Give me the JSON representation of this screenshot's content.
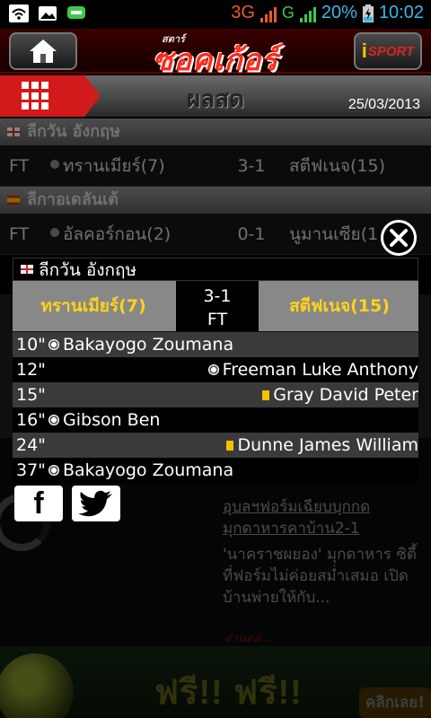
{
  "status_bar": {
    "network": "3G",
    "network2": "G",
    "battery": "20%",
    "time": "10:02"
  },
  "header": {
    "logo_small": "สตาร์",
    "logo_main": "ซอคเก้อร์",
    "right_button_i": "i",
    "right_button_text": "SPORT"
  },
  "titlebar": {
    "title": "ผลสด",
    "date": "25/03/2013"
  },
  "background_list": {
    "leagues": [
      {
        "name": "ลีกวัน  อังกฤษ",
        "matches": [
          {
            "status": "FT",
            "home": "ทรานเมียร์(7)",
            "score": "3-1",
            "away": "สตีฟเนจ(15)"
          }
        ]
      },
      {
        "name": "ลีกาอเดลันเต้",
        "matches": [
          {
            "status": "FT",
            "home": "อัลคอร์กอน(2)",
            "score": "0-1",
            "away": "นูมานเซีย(1"
          }
        ]
      }
    ]
  },
  "popup": {
    "league": "ลีกวัน อังกฤษ",
    "home_team": "ทรานเมียร์(7)",
    "away_team": "สตีฟเนจ(15)",
    "score": "3-1",
    "status": "FT",
    "events": [
      {
        "minute": "10\"",
        "side": "home",
        "type": "goal",
        "player": "Bakayogo Zoumana"
      },
      {
        "minute": "12\"",
        "side": "away",
        "type": "goal",
        "player": "Freeman Luke Anthony"
      },
      {
        "minute": "15\"",
        "side": "away",
        "type": "yellow-card",
        "player": "Gray David  Peter"
      },
      {
        "minute": "16\"",
        "side": "home",
        "type": "goal",
        "player": "Gibson Ben"
      },
      {
        "minute": "24\"",
        "side": "away",
        "type": "yellow-card",
        "player": "Dunne James William"
      },
      {
        "minute": "37\"",
        "side": "home",
        "type": "goal",
        "player": "Bakayogo Zoumana"
      }
    ]
  },
  "social": {
    "facebook": "f",
    "twitter_icon": "twitter-bird-icon"
  },
  "news": {
    "title": "อุบลฯฟอร์มเฉียบบุกกดมุกดาหารคาบ้าน2-1",
    "text": " 'นาคราชผยอง' มุกดาหาร ซิตี้ ที่ฟอร์มไม่ค่อยสม่ำเสมอ เปิดบ้านพ่ายให้กับ...",
    "more": "อ่านต่อ..."
  },
  "banner": {
    "text": "ฟรี!! ฟรี!!",
    "button": "คลิกเลย!"
  },
  "colors": {
    "accent_red": "#d21a1a",
    "team_yellow": "#ffd21a",
    "status_blue": "#3bb6e8"
  }
}
